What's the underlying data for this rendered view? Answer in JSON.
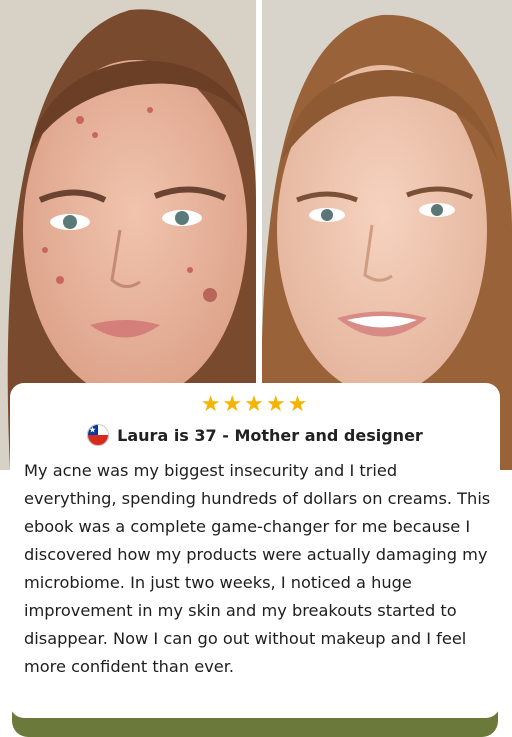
{
  "images": {
    "before": "before-photo-face-with-acne",
    "after": "after-photo-clear-skin-smiling"
  },
  "review": {
    "rating_stars": 5,
    "stars_text": "★★★★★",
    "flag_icon": "chile-flag-icon",
    "reviewer": "Laura is 37 - Mother and designer",
    "text": "My acne was my biggest insecurity and I tried everything, spending hundreds of dollars on creams. This ebook was a complete game-changer for me because I discovered how my products were actually damaging my microbiome. In just two weeks, I noticed a huge improvement in my skin and my breakouts started to disappear. Now I can go out without makeup and I feel more confident than ever."
  },
  "colors": {
    "star": "#f5b400",
    "footer_bar": "#6b7a3a",
    "text": "#1e1e1e"
  }
}
